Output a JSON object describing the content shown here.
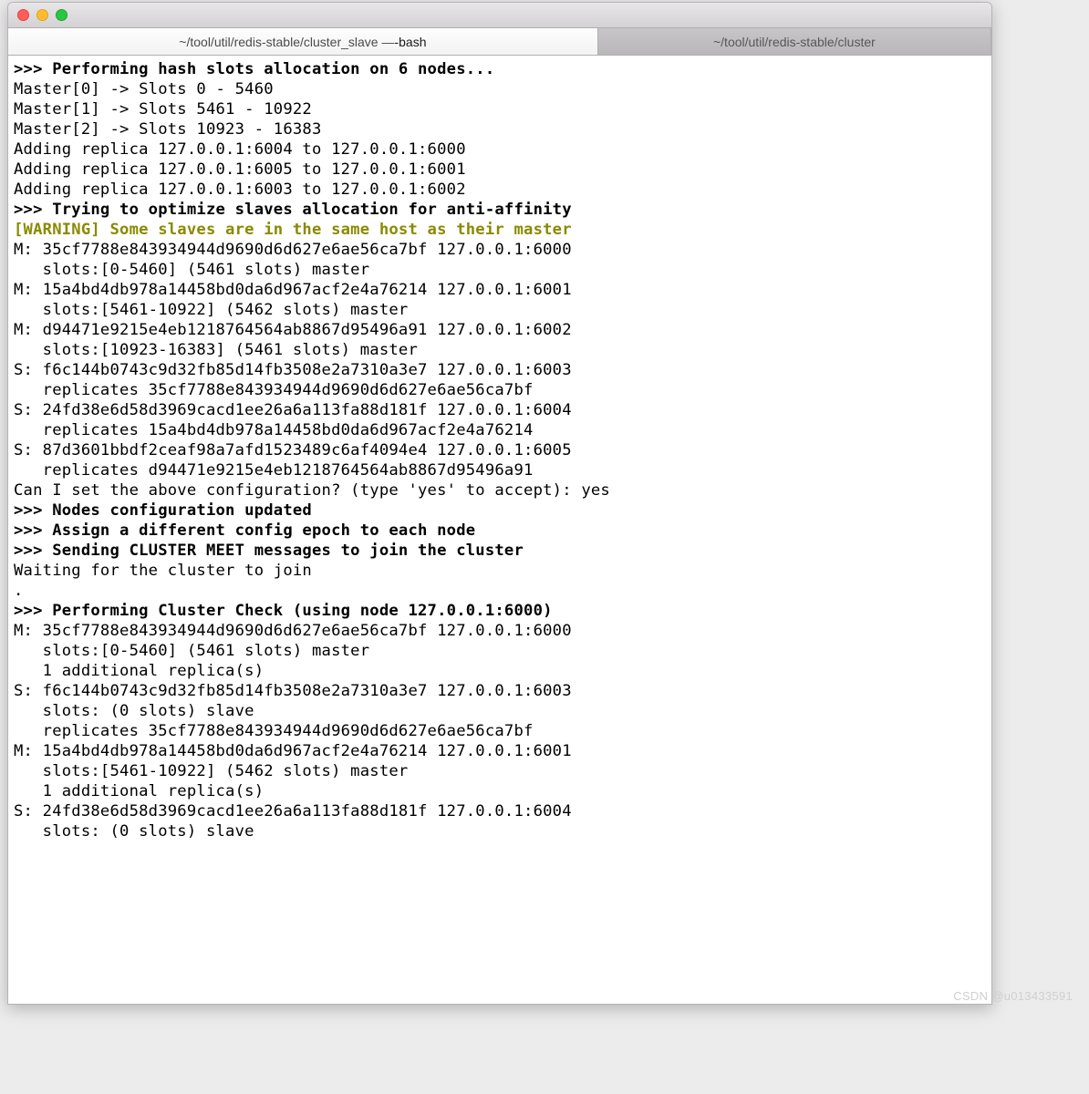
{
  "tabs": [
    {
      "prefix": "~/tool/util/redis-stable/cluster_slave — ",
      "suffix": "-bash"
    },
    {
      "prefix": "~/tool/util/redis-stable/cluster",
      "suffix": ""
    }
  ],
  "watermark": "CSDN @u013433591",
  "lines": [
    {
      "t": ">>> Performing hash slots allocation on 6 nodes...",
      "cls": "b"
    },
    {
      "t": "Master[0] -> Slots 0 - 5460"
    },
    {
      "t": "Master[1] -> Slots 5461 - 10922"
    },
    {
      "t": "Master[2] -> Slots 10923 - 16383"
    },
    {
      "t": "Adding replica 127.0.0.1:6004 to 127.0.0.1:6000"
    },
    {
      "t": "Adding replica 127.0.0.1:6005 to 127.0.0.1:6001"
    },
    {
      "t": "Adding replica 127.0.0.1:6003 to 127.0.0.1:6002"
    },
    {
      "t": ">>> Trying to optimize slaves allocation for anti-affinity",
      "cls": "b"
    },
    {
      "t": "[WARNING] Some slaves are in the same host as their master",
      "cls": "wr"
    },
    {
      "t": "M: 35cf7788e843934944d9690d6d627e6ae56ca7bf 127.0.0.1:6000"
    },
    {
      "t": "   slots:[0-5460] (5461 slots) master"
    },
    {
      "t": "M: 15a4bd4db978a14458bd0da6d967acf2e4a76214 127.0.0.1:6001"
    },
    {
      "t": "   slots:[5461-10922] (5462 slots) master"
    },
    {
      "t": "M: d94471e9215e4eb1218764564ab8867d95496a91 127.0.0.1:6002"
    },
    {
      "t": "   slots:[10923-16383] (5461 slots) master"
    },
    {
      "t": "S: f6c144b0743c9d32fb85d14fb3508e2a7310a3e7 127.0.0.1:6003"
    },
    {
      "t": "   replicates 35cf7788e843934944d9690d6d627e6ae56ca7bf"
    },
    {
      "t": "S: 24fd38e6d58d3969cacd1ee26a6a113fa88d181f 127.0.0.1:6004"
    },
    {
      "t": "   replicates 15a4bd4db978a14458bd0da6d967acf2e4a76214"
    },
    {
      "t": "S: 87d3601bbdf2ceaf98a7afd1523489c6af4094e4 127.0.0.1:6005"
    },
    {
      "t": "   replicates d94471e9215e4eb1218764564ab8867d95496a91"
    },
    {
      "t": "Can I set the above configuration? (type 'yes' to accept): yes"
    },
    {
      "t": ">>> Nodes configuration updated",
      "cls": "b"
    },
    {
      "t": ">>> Assign a different config epoch to each node",
      "cls": "b"
    },
    {
      "t": ">>> Sending CLUSTER MEET messages to join the cluster",
      "cls": "b"
    },
    {
      "t": "Waiting for the cluster to join"
    },
    {
      "t": "."
    },
    {
      "t": ">>> Performing Cluster Check (using node 127.0.0.1:6000)",
      "cls": "b"
    },
    {
      "t": "M: 35cf7788e843934944d9690d6d627e6ae56ca7bf 127.0.0.1:6000"
    },
    {
      "t": "   slots:[0-5460] (5461 slots) master"
    },
    {
      "t": "   1 additional replica(s)"
    },
    {
      "t": "S: f6c144b0743c9d32fb85d14fb3508e2a7310a3e7 127.0.0.1:6003"
    },
    {
      "t": "   slots: (0 slots) slave"
    },
    {
      "t": "   replicates 35cf7788e843934944d9690d6d627e6ae56ca7bf"
    },
    {
      "t": "M: 15a4bd4db978a14458bd0da6d967acf2e4a76214 127.0.0.1:6001"
    },
    {
      "t": "   slots:[5461-10922] (5462 slots) master"
    },
    {
      "t": "   1 additional replica(s)"
    },
    {
      "t": "S: 24fd38e6d58d3969cacd1ee26a6a113fa88d181f 127.0.0.1:6004"
    },
    {
      "t": "   slots: (0 slots) slave"
    }
  ]
}
